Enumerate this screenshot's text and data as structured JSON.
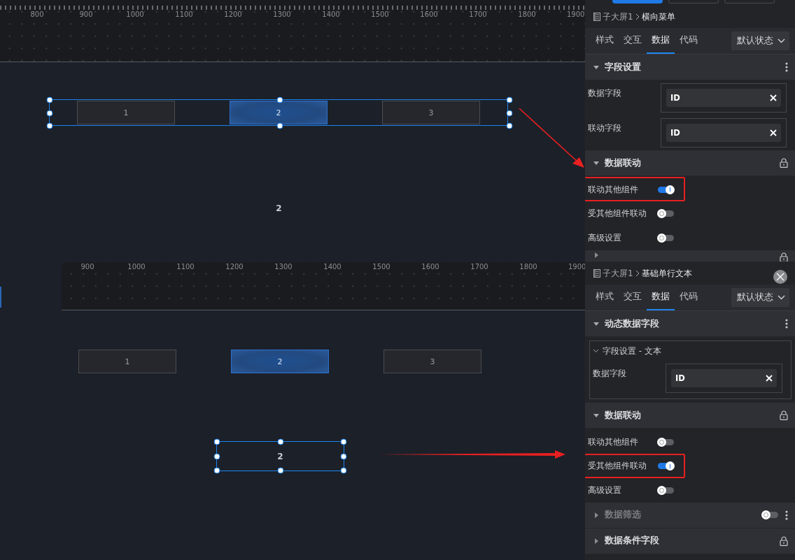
{
  "windows": [
    {
      "canvas": {
        "ruler": {
          "ticks_visible": true,
          "labels": [
            "800",
            "900",
            "1000",
            "1100",
            "1200",
            "1300",
            "1400",
            "1500",
            "1600",
            "1700",
            "1800",
            "1900"
          ]
        },
        "menu": {
          "selected": true,
          "items": [
            {
              "label": "1",
              "selected": false
            },
            {
              "label": "2",
              "selected": true
            },
            {
              "label": "3",
              "selected": false
            }
          ]
        },
        "text_widget": {
          "text": "2",
          "selected": false
        }
      },
      "panel": {
        "top_buttons": [
          {
            "selected": true
          },
          {
            "selected": false
          },
          {
            "selected": false
          }
        ],
        "breadcrumb": {
          "root": "子大屏1",
          "current": "横向菜单"
        },
        "tabs": [
          {
            "label": "样式",
            "selected": false
          },
          {
            "label": "交互",
            "selected": false
          },
          {
            "label": "数据",
            "selected": true
          },
          {
            "label": "代码",
            "selected": false
          }
        ],
        "state_dropdown": "默认状态",
        "sections": [
          {
            "kind": "fields",
            "title": "字段设置",
            "expanded": true,
            "disabled": false,
            "more": true,
            "fields": [
              {
                "label": "数据字段",
                "value": "ID"
              },
              {
                "label": "联动字段",
                "value": "ID"
              }
            ]
          },
          {
            "kind": "toggles",
            "title": "数据联动",
            "expanded": true,
            "disabled": false,
            "lock": true,
            "toggles": [
              {
                "label": "联动其他组件",
                "on": true,
                "highlighted": true
              },
              {
                "label": "受其他组件联动",
                "on": false,
                "highlighted": false
              },
              {
                "label": "高级设置",
                "on": false,
                "highlighted": false
              }
            ]
          },
          {
            "kind": "header",
            "expanded": false,
            "lock": true
          }
        ]
      }
    },
    {
      "canvas": {
        "ruler": {
          "ticks_visible": false,
          "labels": [
            "900",
            "1000",
            "1100",
            "1200",
            "1300",
            "1400",
            "1500",
            "1600",
            "1700",
            "1800",
            "1900"
          ]
        },
        "menu": {
          "selected": false,
          "items": [
            {
              "label": "1",
              "selected": false
            },
            {
              "label": "2",
              "selected": true
            },
            {
              "label": "3",
              "selected": false
            }
          ]
        },
        "text_widget": {
          "text": "2",
          "selected": true
        }
      },
      "panel": {
        "close_button": true,
        "breadcrumb": {
          "root": "子大屏1",
          "current": "基础单行文本"
        },
        "tabs": [
          {
            "label": "样式",
            "selected": false
          },
          {
            "label": "交互",
            "selected": false
          },
          {
            "label": "数据",
            "selected": true
          },
          {
            "label": "代码",
            "selected": false
          }
        ],
        "state_dropdown": "默认状态",
        "sections": [
          {
            "kind": "group",
            "title": "动态数据字段",
            "expanded": true,
            "disabled": false,
            "more": true,
            "group": {
              "title": "字段设置 - 文本",
              "expanded": true,
              "fields": [
                {
                  "label": "数据字段",
                  "value": "ID"
                }
              ]
            }
          },
          {
            "kind": "toggles",
            "title": "数据联动",
            "expanded": true,
            "disabled": false,
            "lock": true,
            "toggles": [
              {
                "label": "联动其他组件",
                "on": false,
                "highlighted": false
              },
              {
                "label": "受其他组件联动",
                "on": true,
                "highlighted": true
              },
              {
                "label": "高级设置",
                "on": false,
                "highlighted": false
              }
            ]
          },
          {
            "kind": "header",
            "title": "数据筛选",
            "expanded": false,
            "disabled": true,
            "on": false,
            "more": true
          },
          {
            "kind": "header",
            "title": "数据条件字段",
            "expanded": false,
            "disabled": false,
            "lock": true
          }
        ]
      }
    }
  ]
}
